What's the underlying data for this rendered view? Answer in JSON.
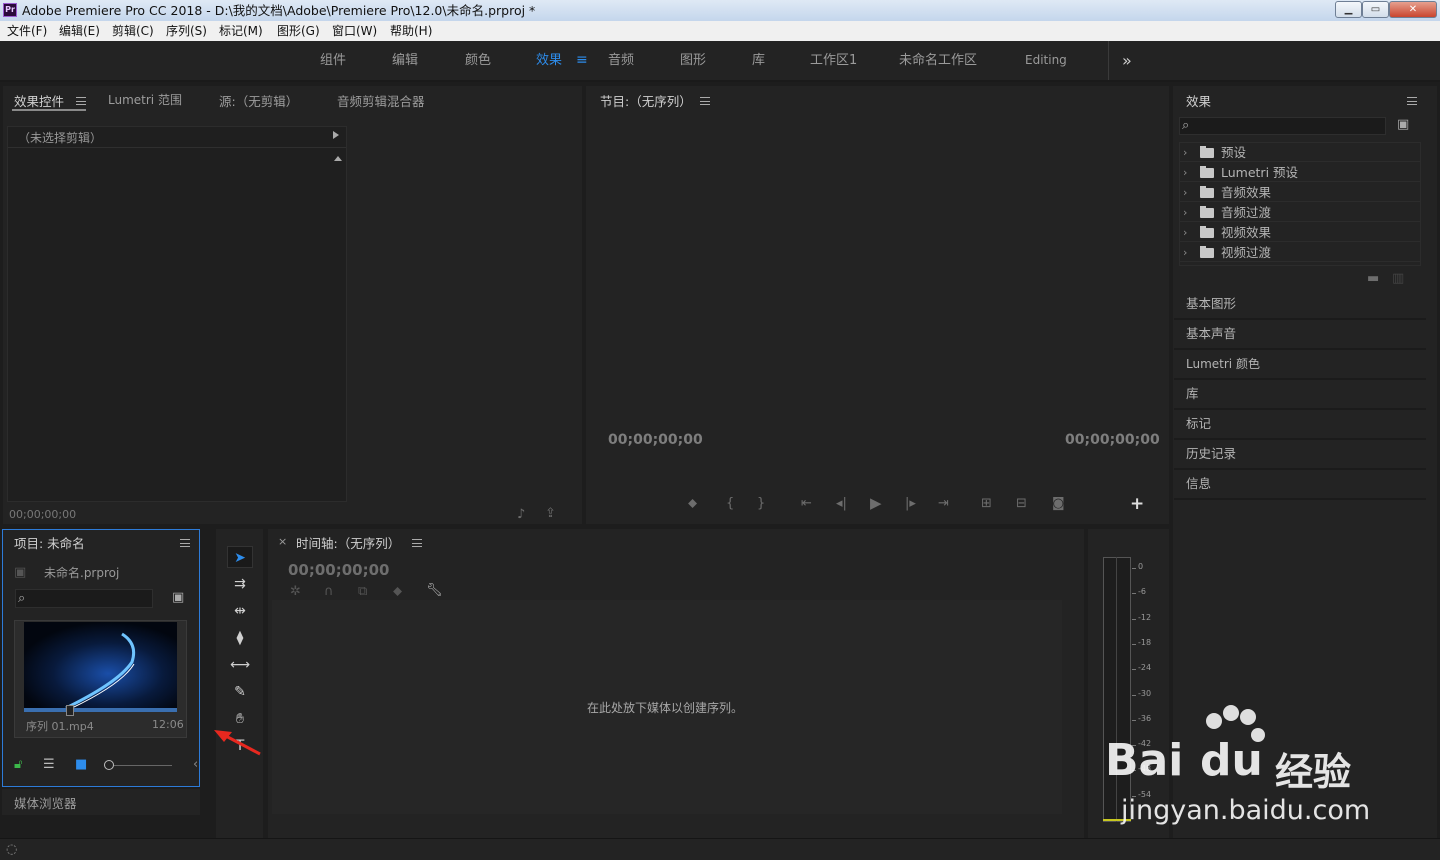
{
  "app": {
    "logo": "Pr",
    "title": "Adobe Premiere Pro CC 2018 - D:\\我的文档\\Adobe\\Premiere Pro\\12.0\\未命名.prproj *",
    "window_buttons": [
      "minimize-icon",
      "maximize-icon",
      "close-icon"
    ]
  },
  "menu": [
    "文件(F)",
    "编辑(E)",
    "剪辑(C)",
    "序列(S)",
    "标记(M)",
    "图形(G)",
    "窗口(W)",
    "帮助(H)"
  ],
  "workspaces": {
    "items": [
      "组件",
      "编辑",
      "颜色",
      "效果",
      "音频",
      "图形",
      "库",
      "工作区1",
      "未命名工作区",
      "Editing"
    ],
    "active": "效果",
    "more": "»"
  },
  "source_panel": {
    "tabs": [
      "效果控件",
      "Lumetri 范围",
      "源:（无剪辑）",
      "音频剪辑混合器"
    ],
    "no_clip": "（未选择剪辑）",
    "timecode": "00;00;00;00"
  },
  "program_panel": {
    "title": "节目:（无序列）",
    "timecode_left": "00;00;00;00",
    "timecode_right": "00;00;00;00",
    "add": "+"
  },
  "effects_panel": {
    "title": "效果",
    "search_placeholder": "",
    "tree": [
      "预设",
      "Lumetri 预设",
      "音频效果",
      "音频过渡",
      "视频效果",
      "视频过渡"
    ]
  },
  "right_panels": [
    "基本图形",
    "基本声音",
    "Lumetri 颜色",
    "库",
    "标记",
    "历史记录",
    "信息"
  ],
  "project_panel": {
    "title": "项目: 未命名",
    "file": "未命名.prproj",
    "search_placeholder": "",
    "clip_name": "序列 01.mp4",
    "clip_duration": "12:06",
    "thumb_progress": 0.3
  },
  "media_browser": "媒体浏览器",
  "timeline": {
    "close": "×",
    "title": "时间轴:（无序列）",
    "timecode": "00;00;00;00",
    "drop_hint": "在此处放下媒体以创建序列。"
  },
  "meter_scale": [
    "0",
    "-6",
    "-12",
    "-18",
    "-24",
    "-30",
    "-36",
    "-42",
    "-48",
    "-54"
  ],
  "watermark": {
    "brand": "Bai",
    "brand2": "du",
    "cn": "经验",
    "url": "jingyan.baidu.com"
  },
  "colors": {
    "accent": "#2d8ceb",
    "panel": "#232323",
    "background": "#1d1d1d",
    "selection_border": "#2d7bd8",
    "arrow": "#e8281f"
  }
}
